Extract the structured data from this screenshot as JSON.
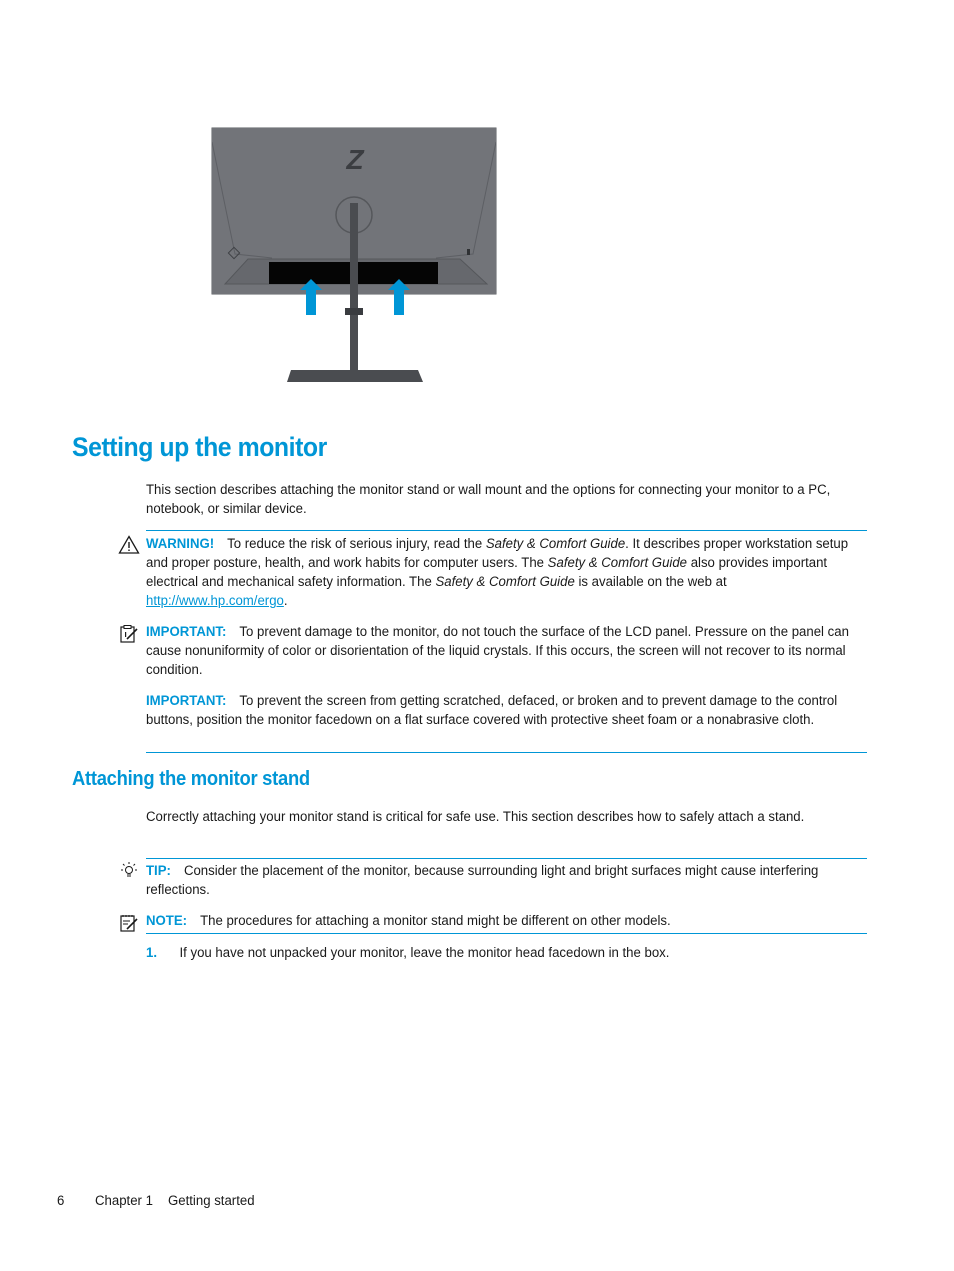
{
  "figure": {
    "description": "Rear view of monitor with stand; arrows indicating stand attachment",
    "logo": "Z",
    "arrow_color": "#0096d6"
  },
  "section": {
    "title": "Setting up the monitor",
    "intro": "This section describes attaching the monitor stand or wall mount and the options for connecting your monitor to a PC, notebook, or similar device."
  },
  "warning": {
    "icon": "warning-triangle-icon",
    "label": "WARNING!",
    "text_1": "To reduce the risk of serious injury, read the ",
    "italic_1": "Safety & Comfort Guide",
    "text_2": ". It describes proper workstation setup and proper posture, health, and work habits for computer users. The ",
    "italic_2": "Safety & Comfort Guide",
    "text_3": " also provides important electrical and mechanical safety information. The ",
    "italic_3": "Safety & Comfort Guide",
    "text_4": " is available on the web at ",
    "link": "http://www.hp.com/ergo",
    "text_5": "."
  },
  "important_1": {
    "icon": "important-clipboard-icon",
    "label": "IMPORTANT:",
    "text": "To prevent damage to the monitor, do not touch the surface of the LCD panel. Pressure on the panel can cause nonuniformity of color or disorientation of the liquid crystals. If this occurs, the screen will not recover to its normal condition."
  },
  "important_2": {
    "label": "IMPORTANT:",
    "text": "To prevent the screen from getting scratched, defaced, or broken and to prevent damage to the control buttons, position the monitor facedown on a flat surface covered with protective sheet foam or a nonabrasive cloth."
  },
  "subsection": {
    "title": "Attaching the monitor stand",
    "intro": "Correctly attaching your monitor stand is critical for safe use. This section describes how to safely attach a stand."
  },
  "tip": {
    "icon": "lightbulb-icon",
    "label": "TIP:",
    "text": "Consider the placement of the monitor, because surrounding light and bright surfaces might cause interfering reflections."
  },
  "note": {
    "icon": "note-pad-icon",
    "label": "NOTE:",
    "text": "The procedures for attaching a monitor stand might be different on other models."
  },
  "steps": [
    {
      "number": "1.",
      "text": "If you have not unpacked your monitor, leave the monitor head facedown in the box."
    }
  ],
  "footer": {
    "page_number": "6",
    "chapter": "Chapter 1",
    "chapter_title": "Getting started"
  },
  "colors": {
    "accent": "#0096d6",
    "text": "#1a1a1a"
  }
}
